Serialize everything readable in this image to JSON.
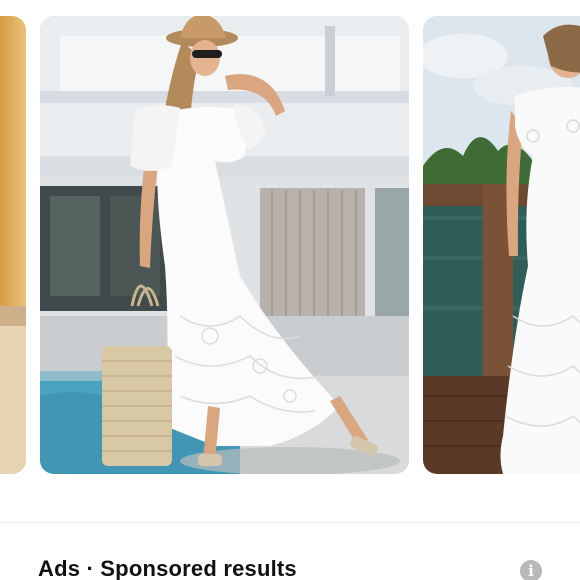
{
  "carousel": {
    "cards": [
      {
        "label": "product-image-partial-left"
      },
      {
        "label": "product-image-white-lace-dress-with-hat-and-bag"
      },
      {
        "label": "product-image-white-lace-dress-by-water"
      }
    ]
  },
  "ads": {
    "title": "Ads · Sponsored results",
    "info_icon": "info-icon",
    "info_glyph": "i"
  }
}
